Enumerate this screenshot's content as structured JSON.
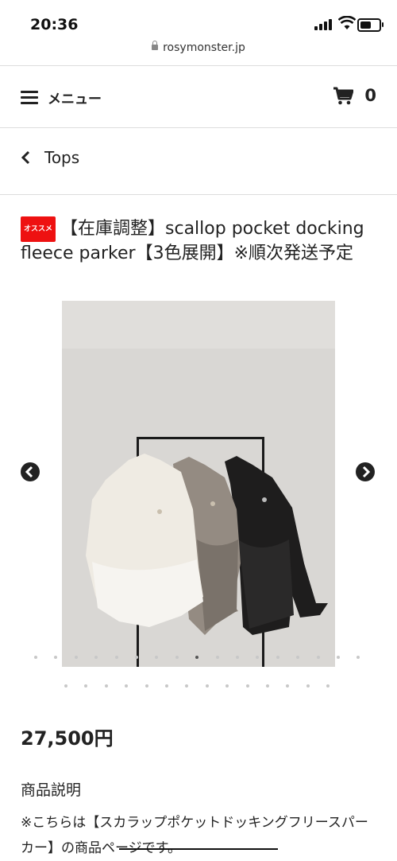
{
  "status_bar": {
    "time": "20:36",
    "url": "rosymonster.jp"
  },
  "header": {
    "menu_label": "メニュー",
    "cart_count": "0"
  },
  "breadcrumb": {
    "label": "Tops"
  },
  "product": {
    "badge": "オススメ",
    "title": "【在庫調整】scallop pocket docking fleece parker【3色展開】※順次発送予定",
    "price": "27,500円",
    "description_heading": "商品説明",
    "description": "※こちらは【スカラップポケットドッキングフリースパーカー】の商品ページです。"
  },
  "gallery": {
    "image_alt": "Three scallop pocket docking fleece parkers (ivory, grey, black) hanging on a rack",
    "colors": {
      "ivory": "#efebe3",
      "grey": "#948b82",
      "black": "#1e1d1d",
      "wall": "#d9d7d4"
    },
    "dots_row1": 17,
    "dots_row2": 14,
    "active_dot": 8
  },
  "icons": [
    "lock-icon",
    "hamburger-icon",
    "cart-icon",
    "chevron-left-icon",
    "arrow-left-icon",
    "arrow-right-icon"
  ]
}
